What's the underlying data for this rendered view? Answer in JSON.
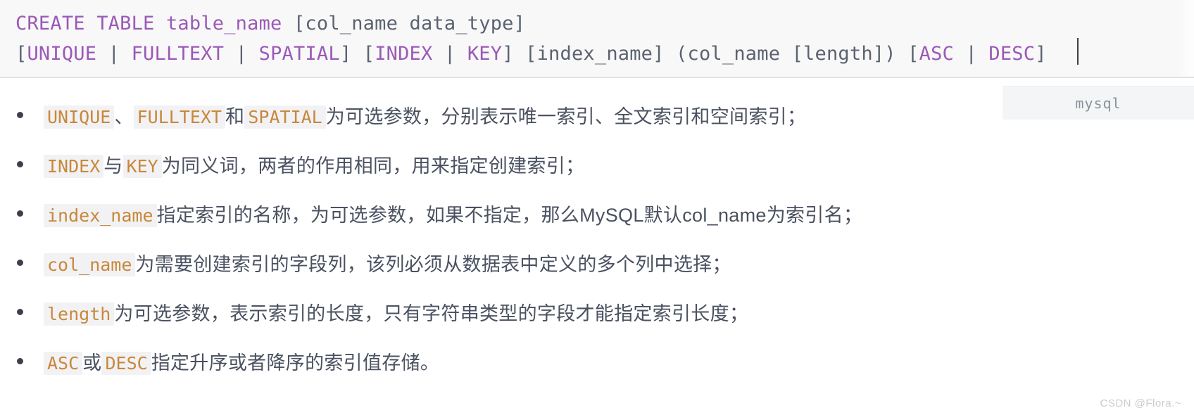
{
  "code_block": {
    "language_label": "mysql",
    "line1": [
      {
        "t": "CREATE TABLE ",
        "k": true
      },
      {
        "t": "table_name",
        "k": true
      },
      {
        "t": " [col_name data_type]",
        "k": false
      }
    ],
    "line1_plain": "CREATE TABLE table_name [col_name data_type]",
    "line2_plain": "[UNIQUE | FULLTEXT | SPATIAL] [INDEX | KEY] [index_name] (col_name [length]) [ASC | DESC]",
    "tokens_line1": {
      "create": "CREATE",
      "table": "TABLE",
      "table_name": "table_name",
      "rest": " [col_name data_type]"
    },
    "tokens_line2": {
      "b1_open": "[",
      "unique": "UNIQUE",
      "p1": " | ",
      "fulltext": "FULLTEXT",
      "p2": " | ",
      "spatial": "SPATIAL",
      "b1_close": "] [",
      "index": "INDEX",
      "p3": " | ",
      "key": "KEY",
      "b2_close": "] [index_name] (col_name [length]) [",
      "asc": "ASC",
      "p4": " | ",
      "desc": "DESC",
      "b3_close": "]"
    }
  },
  "bullets": [
    {
      "code1": "UNIQUE",
      "sep1": "、",
      "code2": "FULLTEXT",
      "sep2": "和",
      "code3": "SPATIAL",
      "tail": "为可选参数，分别表示唯一索引、全文索引和空间索引；"
    },
    {
      "code1": "INDEX",
      "sep1": "与",
      "code2": "KEY",
      "tail": "为同义词，两者的作用相同，用来指定创建索引；"
    },
    {
      "code1": "index_name",
      "tail": "指定索引的名称，为可选参数，如果不指定，那么MySQL默认col_name为索引名；"
    },
    {
      "code1": "col_name",
      "tail": "为需要创建索引的字段列，该列必须从数据表中定义的多个列中选择；"
    },
    {
      "code1": "length",
      "tail": "为可选参数，表示索引的长度，只有字符串类型的字段才能指定索引长度；"
    },
    {
      "code1": "ASC",
      "sep1": "或",
      "code2": "DESC",
      "tail": "指定升序或者降序的索引值存储。"
    }
  ],
  "watermark": "CSDN @Flora.~",
  "colors": {
    "code_bg": "#f8f8f9",
    "keyword_purple": "#9b59b6",
    "code_text": "#5b6270",
    "inline_code_orange": "#c8883a",
    "body_text": "#4a5160"
  }
}
